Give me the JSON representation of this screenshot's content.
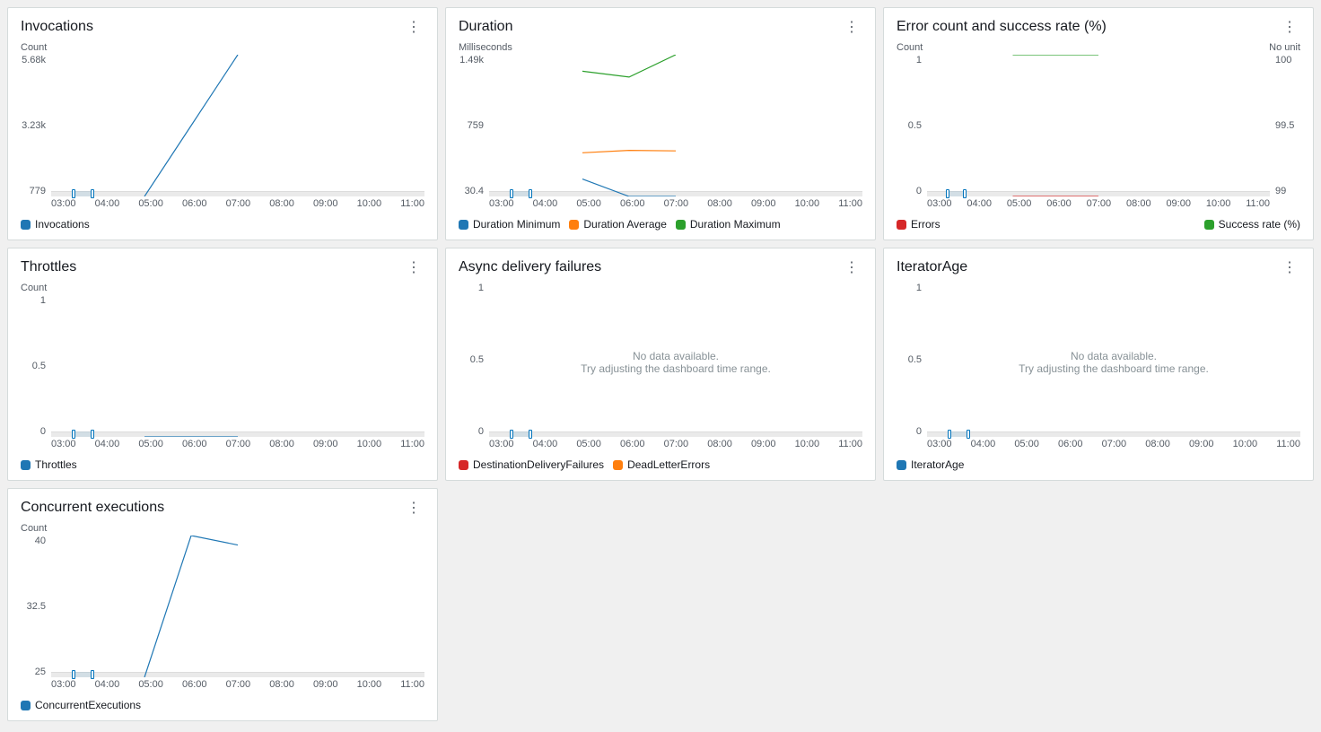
{
  "colors": {
    "blue": "#1f77b4",
    "orange": "#ff7f0e",
    "green": "#2ca02c",
    "red": "#d62728"
  },
  "x_ticks": [
    "03:00",
    "04:00",
    "05:00",
    "06:00",
    "07:00",
    "08:00",
    "09:00",
    "10:00",
    "11:00"
  ],
  "nodata": {
    "line1": "No data available.",
    "line2": "Try adjusting the dashboard time range."
  },
  "panels": [
    {
      "id": "invocations",
      "title": "Invocations",
      "unit_left": "Count",
      "y_ticks": [
        "5.68k",
        "3.23k",
        "779"
      ],
      "legend": [
        {
          "color": "blue",
          "label": "Invocations"
        }
      ]
    },
    {
      "id": "duration",
      "title": "Duration",
      "unit_left": "Milliseconds",
      "y_ticks": [
        "1.49k",
        "759",
        "30.4"
      ],
      "legend": [
        {
          "color": "blue",
          "label": "Duration Minimum"
        },
        {
          "color": "orange",
          "label": "Duration Average"
        },
        {
          "color": "green",
          "label": "Duration Maximum"
        }
      ]
    },
    {
      "id": "errors",
      "title": "Error count and success rate (%)",
      "unit_left": "Count",
      "unit_right": "No unit",
      "y_ticks": [
        "1",
        "0.5",
        "0"
      ],
      "y_ticks_right": [
        "100",
        "99.5",
        "99"
      ],
      "legend": [
        {
          "color": "red",
          "label": "Errors"
        },
        {
          "color": "green",
          "label": "Success rate (%)",
          "right": true
        }
      ]
    },
    {
      "id": "throttles",
      "title": "Throttles",
      "unit_left": "Count",
      "y_ticks": [
        "1",
        "0.5",
        "0"
      ],
      "legend": [
        {
          "color": "blue",
          "label": "Throttles"
        }
      ]
    },
    {
      "id": "async",
      "title": "Async delivery failures",
      "y_ticks": [
        "1",
        "0.5",
        "0"
      ],
      "nodata": true,
      "legend": [
        {
          "color": "red",
          "label": "DestinationDeliveryFailures"
        },
        {
          "color": "orange",
          "label": "DeadLetterErrors"
        }
      ]
    },
    {
      "id": "iteratorage",
      "title": "IteratorAge",
      "y_ticks": [
        "1",
        "0.5",
        "0"
      ],
      "nodata": true,
      "legend": [
        {
          "color": "blue",
          "label": "IteratorAge"
        }
      ]
    },
    {
      "id": "concurrent",
      "title": "Concurrent executions",
      "unit_left": "Count",
      "y_ticks": [
        "40",
        "32.5",
        "25"
      ],
      "legend": [
        {
          "color": "blue",
          "label": "ConcurrentExecutions"
        }
      ]
    }
  ],
  "chart_data": [
    {
      "id": "invocations",
      "type": "line",
      "title": "Invocations",
      "xlabel": "",
      "ylabel": "Count",
      "x": [
        "05:00",
        "06:00",
        "07:00"
      ],
      "ylim": [
        779,
        5680
      ],
      "series": [
        {
          "name": "Invocations",
          "color": "#1f77b4",
          "values": [
            779,
            3230,
            5680
          ]
        }
      ]
    },
    {
      "id": "duration",
      "type": "line",
      "title": "Duration",
      "xlabel": "",
      "ylabel": "Milliseconds",
      "x": [
        "05:00",
        "06:00",
        "07:00"
      ],
      "ylim": [
        30.4,
        1490
      ],
      "series": [
        {
          "name": "Duration Minimum",
          "color": "#1f77b4",
          "values": [
            210,
            30.4,
            30.4
          ]
        },
        {
          "name": "Duration Average",
          "color": "#ff7f0e",
          "values": [
            480,
            505,
            500
          ]
        },
        {
          "name": "Duration Maximum",
          "color": "#2ca02c",
          "values": [
            1320,
            1260,
            1490
          ]
        }
      ]
    },
    {
      "id": "errors",
      "type": "line",
      "title": "Error count and success rate (%)",
      "xlabel": "",
      "ylabel": "Count",
      "ylabel_right": "No unit",
      "x": [
        "05:00",
        "06:00",
        "07:00"
      ],
      "ylim": [
        0,
        1
      ],
      "ylim_right": [
        99,
        100
      ],
      "series": [
        {
          "name": "Errors",
          "axis": "left",
          "color": "#d62728",
          "values": [
            0,
            0,
            0
          ]
        },
        {
          "name": "Success rate (%)",
          "axis": "right",
          "color": "#2ca02c",
          "values": [
            100,
            100,
            100
          ]
        }
      ]
    },
    {
      "id": "throttles",
      "type": "line",
      "title": "Throttles",
      "xlabel": "",
      "ylabel": "Count",
      "x": [
        "05:00",
        "06:00",
        "07:00"
      ],
      "ylim": [
        0,
        1
      ],
      "series": [
        {
          "name": "Throttles",
          "color": "#1f77b4",
          "values": [
            0,
            0,
            0
          ]
        }
      ]
    },
    {
      "id": "async",
      "type": "line",
      "title": "Async delivery failures",
      "x": [],
      "ylim": [
        0,
        1
      ],
      "series": [
        {
          "name": "DestinationDeliveryFailures",
          "color": "#d62728",
          "values": []
        },
        {
          "name": "DeadLetterErrors",
          "color": "#ff7f0e",
          "values": []
        }
      ],
      "annotations": [
        "No data available.",
        "Try adjusting the dashboard time range."
      ]
    },
    {
      "id": "iteratorage",
      "type": "line",
      "title": "IteratorAge",
      "x": [],
      "ylim": [
        0,
        1
      ],
      "series": [
        {
          "name": "IteratorAge",
          "color": "#1f77b4",
          "values": []
        }
      ],
      "annotations": [
        "No data available.",
        "Try adjusting the dashboard time range."
      ]
    },
    {
      "id": "concurrent",
      "type": "line",
      "title": "Concurrent executions",
      "xlabel": "",
      "ylabel": "Count",
      "x": [
        "05:00",
        "06:00",
        "07:00"
      ],
      "ylim": [
        25,
        40
      ],
      "series": [
        {
          "name": "ConcurrentExecutions",
          "color": "#1f77b4",
          "values": [
            25,
            40,
            39
          ]
        }
      ]
    }
  ]
}
